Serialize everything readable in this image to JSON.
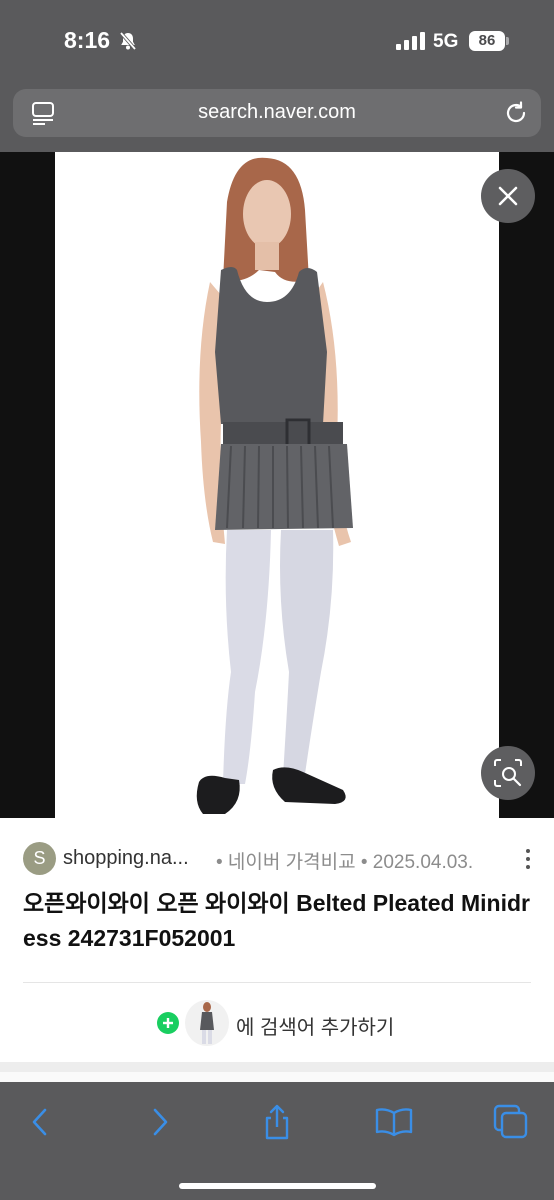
{
  "status_bar": {
    "time": "8:16",
    "network": "5G",
    "battery": "86"
  },
  "browser": {
    "url": "search.naver.com"
  },
  "result": {
    "source_initial": "S",
    "source_name": "shopping.na...",
    "meta": "• 네이버 가격비교 • 2025.04.03.",
    "title": "오픈와이와이 오픈 와이와이 Belted Pleated Minidress 242731F052001",
    "add_search_text": "에 검색어 추가하기"
  },
  "colors": {
    "accent_green": "#19ce60",
    "toolbar_blue": "#3a8ee6"
  }
}
